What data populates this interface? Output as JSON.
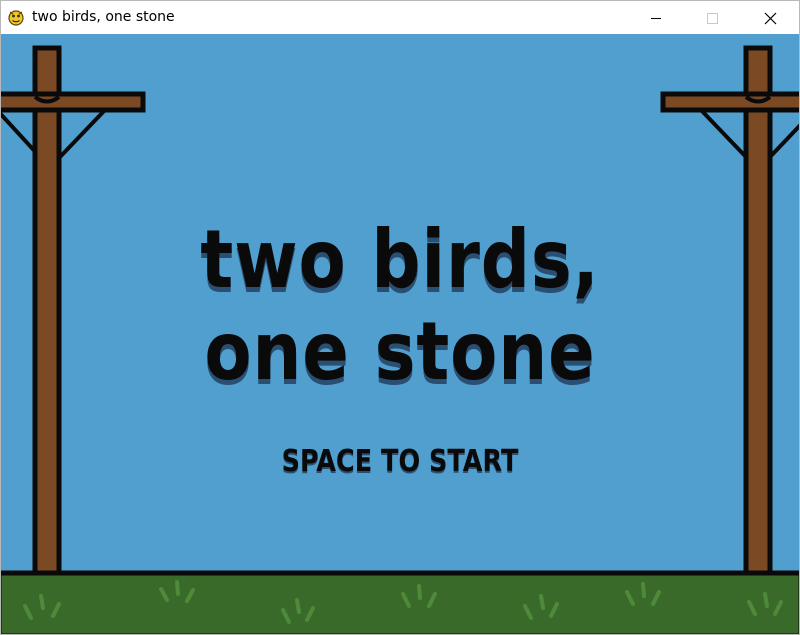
{
  "window": {
    "title": "two birds, one stone",
    "app_icon": "pygame-snake-icon",
    "controls": {
      "minimize_icon": "minimize-icon",
      "maximize_icon": "maximize-icon",
      "close_icon": "close-icon"
    }
  },
  "game": {
    "title_line1": "two birds,",
    "title_line2": "one stone",
    "start_prompt": "SPACE TO START",
    "colors": {
      "sky": "#519fcf",
      "pole": "#7b4a24",
      "outline": "#0a0a0a",
      "grass": "#3a6a2a",
      "grass_tuft": "#4e8a3a"
    }
  }
}
